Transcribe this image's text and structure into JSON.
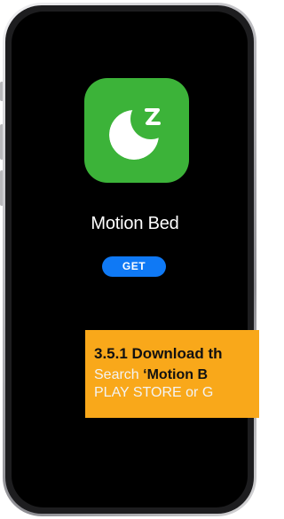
{
  "app": {
    "name": "Motion Bed",
    "get_label": "GET",
    "icon": "crescent-moon-z-icon",
    "icon_color": "#3cb339",
    "button_color": "#0f79f5"
  },
  "callout": {
    "title": "3.5.1 Download th",
    "line1_prefix": "Search ",
    "line1_bold": "‘Motion B",
    "line2": "PLAY STORE or G",
    "background": "#f9a81a"
  }
}
